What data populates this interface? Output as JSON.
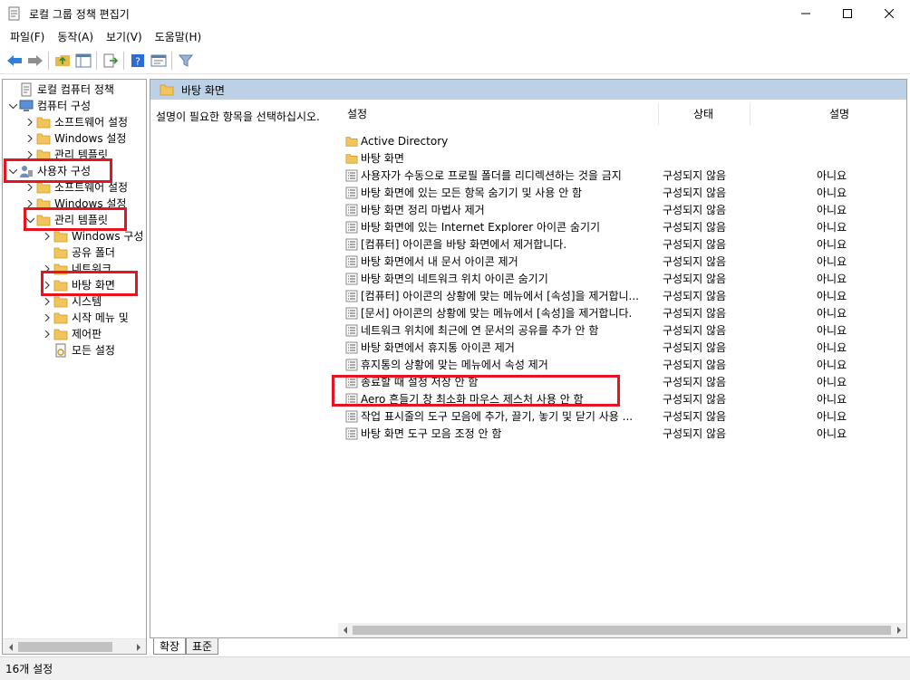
{
  "window": {
    "title": "로컬 그룹 정책 편집기"
  },
  "menu": [
    "파일(F)",
    "동작(A)",
    "보기(V)",
    "도움말(H)"
  ],
  "tree": [
    {
      "label": "로컬 컴퓨터 정책",
      "icon": "policy-icon"
    },
    {
      "label": "컴퓨터 구성",
      "icon": "computer-icon"
    },
    {
      "label": "소프트웨어 설정",
      "icon": "folder-icon"
    },
    {
      "label": "Windows 설정",
      "icon": "folder-icon"
    },
    {
      "label": "관리 템플릿",
      "icon": "folder-icon"
    },
    {
      "label": "사용자 구성",
      "icon": "user-icon"
    },
    {
      "label": "소프트웨어 설정",
      "icon": "folder-icon"
    },
    {
      "label": "Windows 설정",
      "icon": "folder-icon"
    },
    {
      "label": "관리 템플릿",
      "icon": "folder-icon"
    },
    {
      "label": "Windows 구성",
      "icon": "folder-icon"
    },
    {
      "label": "공유 폴더",
      "icon": "folder-icon"
    },
    {
      "label": "네트워크",
      "icon": "folder-icon"
    },
    {
      "label": "바탕 화면",
      "icon": "folder-icon"
    },
    {
      "label": "시스템",
      "icon": "folder-icon"
    },
    {
      "label": "시작 메뉴 및",
      "icon": "folder-icon"
    },
    {
      "label": "제어판",
      "icon": "folder-icon"
    },
    {
      "label": "모든 설정",
      "icon": "all-settings-icon"
    }
  ],
  "content": {
    "header": "바탕 화면",
    "description": "설명이 필요한 항목을 선택하십시오.",
    "columns": {
      "name": "설정",
      "state": "상태",
      "note": "설명"
    },
    "folders": [
      "Active Directory",
      "바탕 화면"
    ],
    "settings": [
      {
        "name": "사용자가 수동으로 프로필 폴더를 리디렉션하는 것을 금지",
        "state": "구성되지 않음",
        "note": "아니요"
      },
      {
        "name": "바탕 화면에 있는 모든 항목 숨기기 및 사용 안 함",
        "state": "구성되지 않음",
        "note": "아니요"
      },
      {
        "name": "바탕 화면 정리 마법사 제거",
        "state": "구성되지 않음",
        "note": "아니요"
      },
      {
        "name": "바탕 화면에 있는 Internet Explorer 아이콘 숨기기",
        "state": "구성되지 않음",
        "note": "아니요"
      },
      {
        "name": "[컴퓨터] 아이콘을 바탕 화면에서 제거합니다.",
        "state": "구성되지 않음",
        "note": "아니요"
      },
      {
        "name": "바탕 화면에서 내 문서 아이콘 제거",
        "state": "구성되지 않음",
        "note": "아니요"
      },
      {
        "name": "바탕 화면의 네트워크 위치 아이콘 숨기기",
        "state": "구성되지 않음",
        "note": "아니요"
      },
      {
        "name": "[컴퓨터] 아이콘의 상황에 맞는 메뉴에서 [속성]을 제거합니...",
        "state": "구성되지 않음",
        "note": "아니요"
      },
      {
        "name": "[문서] 아이콘의 상황에 맞는 메뉴에서 [속성]을 제거합니다.",
        "state": "구성되지 않음",
        "note": "아니요"
      },
      {
        "name": "네트워크 위치에 최근에 연 문서의 공유를 추가 안 함",
        "state": "구성되지 않음",
        "note": "아니요"
      },
      {
        "name": "바탕 화면에서 휴지통 아이콘 제거",
        "state": "구성되지 않음",
        "note": "아니요"
      },
      {
        "name": "휴지통의 상황에 맞는 메뉴에서 속성 제거",
        "state": "구성되지 않음",
        "note": "아니요"
      },
      {
        "name": "종료할 때 설정 저장 안 함",
        "state": "구성되지 않음",
        "note": "아니요"
      },
      {
        "name": "Aero 흔들기 창 최소화 마우스 제스처 사용 안 함",
        "state": "구성되지 않음",
        "note": "아니요"
      },
      {
        "name": "작업 표시줄의 도구 모음에 추가, 끌기, 놓기 및 닫기 사용 ...",
        "state": "구성되지 않음",
        "note": "아니요"
      },
      {
        "name": "바탕 화면 도구 모음 조정 안 함",
        "state": "구성되지 않음",
        "note": "아니요"
      }
    ]
  },
  "tabs": [
    "확장",
    "표준"
  ],
  "status": "16개 설정",
  "colors": {
    "highlight": "#e8131f",
    "header_bar": "#bdd1e6",
    "folder": "#f2c55c"
  }
}
